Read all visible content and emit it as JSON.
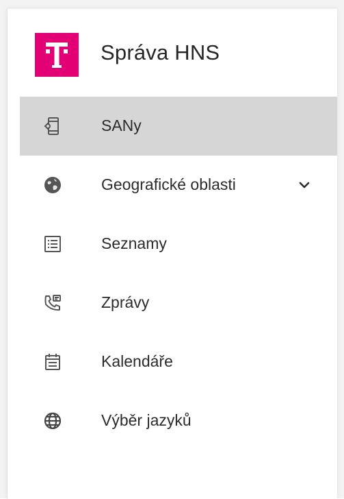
{
  "app": {
    "title": "Správa HNS",
    "brand_color": "#e20074",
    "logo_icon": "telekom-t-logo"
  },
  "nav": {
    "active_background": "#d6d6d6",
    "items": [
      {
        "label": "SANy",
        "icon": "device-settings-icon",
        "active": true
      },
      {
        "label": "Geografické oblasti",
        "icon": "globe-icon",
        "expandable": true
      },
      {
        "label": "Seznamy",
        "icon": "list-icon"
      },
      {
        "label": "Zprávy",
        "icon": "phone-message-icon"
      },
      {
        "label": "Kalendáře",
        "icon": "calendar-icon"
      },
      {
        "label": "Výběr jazyků",
        "icon": "language-globe-icon"
      }
    ]
  }
}
